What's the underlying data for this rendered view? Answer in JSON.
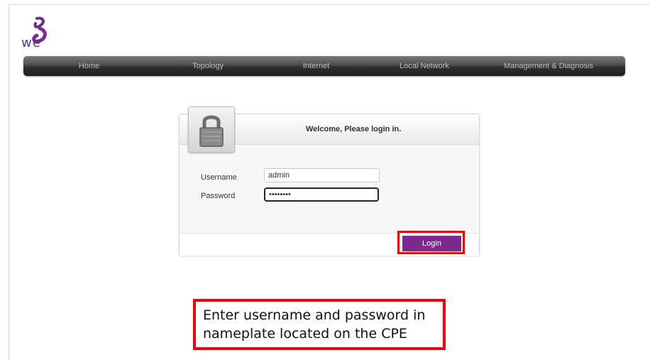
{
  "brand": {
    "logo_text": "we",
    "accent_color": "#7b2a8e"
  },
  "nav": {
    "items": [
      {
        "label": "Home"
      },
      {
        "label": "Topology"
      },
      {
        "label": "Internet"
      },
      {
        "label": "Local Network"
      },
      {
        "label": "Management & Diagnosis"
      }
    ]
  },
  "login": {
    "welcome": "Welcome, Please login in.",
    "username_label": "Username",
    "username_value": "admin",
    "password_label": "Password",
    "password_value": "••••••••",
    "button_label": "Login",
    "lock_icon": "lock-icon"
  },
  "annotation": {
    "note": "Enter username and password in nameplate located on the CPE",
    "highlight_color": "#ff0000"
  }
}
